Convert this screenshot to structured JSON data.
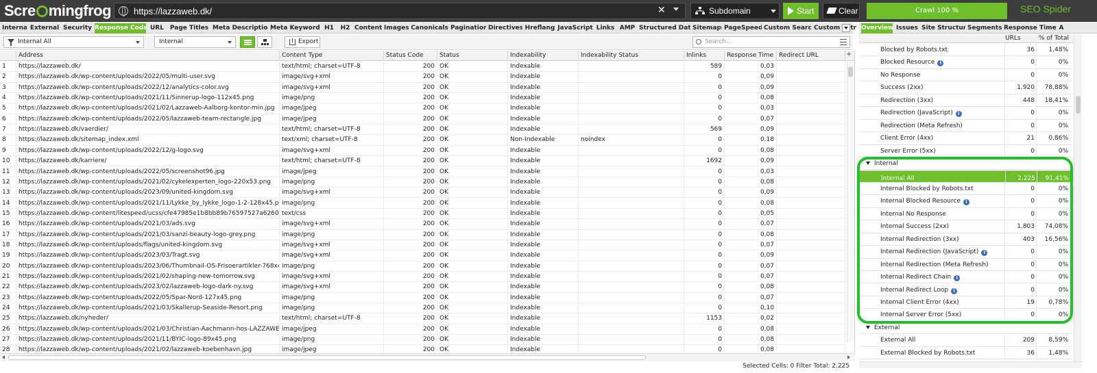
{
  "app": {
    "logo_pre": "Scre",
    "logo_post": "mingfrog",
    "brand": "SEO Spider",
    "url": "https://lazzaweb.dk/",
    "url_clear": "✕",
    "mode": "Subdomain",
    "start_label": "Start",
    "clear_label": "Clear",
    "progress_label": "Crawl 100 %",
    "progress_value": 1.0,
    "accent_color": "#6fbf2c"
  },
  "tabs": [
    {
      "label": "Internal",
      "active": false
    },
    {
      "label": "External",
      "active": false
    },
    {
      "label": "Security",
      "active": false
    },
    {
      "label": "Response Codes",
      "active": true
    },
    {
      "label": "URL",
      "active": false
    },
    {
      "label": "Page Titles",
      "active": false
    },
    {
      "label": "Meta Description",
      "active": false
    },
    {
      "label": "Meta Keywords",
      "active": false
    },
    {
      "label": "H1",
      "active": false
    },
    {
      "label": "H2",
      "active": false
    },
    {
      "label": "Content",
      "active": false
    },
    {
      "label": "Images",
      "active": false
    },
    {
      "label": "Canonicals",
      "active": false
    },
    {
      "label": "Pagination",
      "active": false
    },
    {
      "label": "Directives",
      "active": false
    },
    {
      "label": "Hreflang",
      "active": false
    },
    {
      "label": "JavaScript",
      "active": false
    },
    {
      "label": "Links",
      "active": false
    },
    {
      "label": "AMP",
      "active": false
    },
    {
      "label": "Structured Data",
      "active": false
    },
    {
      "label": "Sitemaps",
      "active": false
    },
    {
      "label": "PageSpeed",
      "active": false
    },
    {
      "label": "Custom Search",
      "active": false
    },
    {
      "label": "Custom Extrac",
      "active": false
    }
  ],
  "filterbar": {
    "filter": "Internal All",
    "scope": "Internal",
    "export_label": "Export",
    "search_placeholder": "Search..."
  },
  "grid": {
    "columns": [
      "Address",
      "Content Type",
      "Status Code",
      "Status",
      "Indexability",
      "Indexability Status",
      "Inlinks",
      "Response Time",
      "Redirect URL"
    ],
    "rows": [
      [
        "1",
        "https://lazzaweb.dk/",
        "text/html; charset=UTF-8",
        "200",
        "OK",
        "Indexable",
        "",
        "589",
        "0,03"
      ],
      [
        "2",
        "https://lazzaweb.dk/wp-content/uploads/2022/05/multi-user.svg",
        "image/svg+xml",
        "200",
        "OK",
        "Indexable",
        "",
        "0",
        "0,09"
      ],
      [
        "3",
        "https://lazzaweb.dk/wp-content/uploads/2022/12/analytics-color.svg",
        "image/svg+xml",
        "200",
        "OK",
        "Indexable",
        "",
        "0",
        "0,09"
      ],
      [
        "4",
        "https://lazzaweb.dk/wp-content/uploads/2021/11/Sinnerup-logo-112x45.png",
        "image/png",
        "200",
        "OK",
        "Indexable",
        "",
        "0",
        "0,08"
      ],
      [
        "5",
        "https://lazzaweb.dk/wp-content/uploads/2021/02/Lazzaweb-Aalborg-kontor-min.jpg",
        "image/jpeg",
        "200",
        "OK",
        "Indexable",
        "",
        "0",
        "0,03"
      ],
      [
        "6",
        "https://lazzaweb.dk/wp-content/uploads/2022/05/lazzaweb-team-rectangle.jpg",
        "image/jpeg",
        "200",
        "OK",
        "Indexable",
        "",
        "0",
        "0,07"
      ],
      [
        "7",
        "https://lazzaweb.dk/vaerdier/",
        "text/html; charset=UTF-8",
        "200",
        "OK",
        "Indexable",
        "",
        "569",
        "0,09"
      ],
      [
        "8",
        "https://lazzaweb.dk/sitemap_index.xml",
        "text/xml; charset=UTF-8",
        "200",
        "OK",
        "Non-Indexable",
        "noindex",
        "0",
        "0,18"
      ],
      [
        "9",
        "https://lazzaweb.dk/wp-content/uploads/2022/12/g-logo.svg",
        "image/svg+xml",
        "200",
        "OK",
        "Indexable",
        "",
        "0",
        "0,08"
      ],
      [
        "10",
        "https://lazzaweb.dk/karriere/",
        "text/html; charset=UTF-8",
        "200",
        "OK",
        "Indexable",
        "",
        "1692",
        "0,09"
      ],
      [
        "11",
        "https://lazzaweb.dk/wp-content/uploads/2022/05/screenshot96.jpg",
        "image/jpeg",
        "200",
        "OK",
        "Indexable",
        "",
        "0",
        "0,03"
      ],
      [
        "12",
        "https://lazzaweb.dk/wp-content/uploads/2021/02/cykelexperten_logo-220x53.png",
        "image/png",
        "200",
        "OK",
        "Indexable",
        "",
        "0",
        "0,08"
      ],
      [
        "13",
        "https://lazzaweb.dk/wp-content/uploads/2023/09/united-kingdom.svg",
        "image/svg+xml",
        "200",
        "OK",
        "Indexable",
        "",
        "0",
        "0,09"
      ],
      [
        "14",
        "https://lazzaweb.dk/wp-content/uploads/2021/11/Lykke_by_lykke_logo-1-2-128x45.png",
        "image/png",
        "200",
        "OK",
        "Indexable",
        "",
        "0",
        "0,08"
      ],
      [
        "15",
        "https://lazzaweb.dk/wp-content/litespeed/ucss/cfe47985e1b8bb89b76597527a62603e.c...",
        "text/css",
        "200",
        "OK",
        "Indexable",
        "",
        "0",
        "0,05"
      ],
      [
        "16",
        "https://lazzaweb.dk/wp-content/uploads/2021/03/ads.svg",
        "image/svg+xml",
        "200",
        "OK",
        "Indexable",
        "",
        "0",
        "0,07"
      ],
      [
        "17",
        "https://lazzaweb.dk/wp-content/uploads/2021/03/sanzi-beauty-logo-grey.png",
        "image/png",
        "200",
        "OK",
        "Indexable",
        "",
        "0",
        "0,08"
      ],
      [
        "18",
        "https://lazzaweb.dk/wp-content/uploads/flags/united-kingdom.svg",
        "image/svg+xml",
        "200",
        "OK",
        "Indexable",
        "",
        "0",
        "0,07"
      ],
      [
        "19",
        "https://lazzaweb.dk/wp-content/uploads/2023/03/Tragt.svg",
        "image/svg+xml",
        "200",
        "OK",
        "Indexable",
        "",
        "0",
        "0,09"
      ],
      [
        "20",
        "https://lazzaweb.dk/wp-content/uploads/2023/06/Thumbnail-OS-Frisoerartikler-768x432....",
        "image/png",
        "200",
        "OK",
        "Indexable",
        "",
        "0",
        "0,07"
      ],
      [
        "21",
        "https://lazzaweb.dk/wp-content/uploads/2021/02/shaping-new-tomorrow.svg",
        "image/svg+xml",
        "200",
        "OK",
        "Indexable",
        "",
        "0",
        "0,07"
      ],
      [
        "22",
        "https://lazzaweb.dk/wp-content/uploads/2023/02/lazzaweb-logo-dark-ny.svg",
        "image/svg+xml",
        "200",
        "OK",
        "Indexable",
        "",
        "0",
        "0,08"
      ],
      [
        "23",
        "https://lazzaweb.dk/wp-content/uploads/2022/05/Spar-Nord-127x45.png",
        "image/png",
        "200",
        "OK",
        "Indexable",
        "",
        "0",
        "0,07"
      ],
      [
        "24",
        "https://lazzaweb.dk/wp-content/uploads/2021/03/Skallerup-Seaside-Resort.png",
        "image/png",
        "200",
        "OK",
        "Indexable",
        "",
        "0",
        "0,10"
      ],
      [
        "25",
        "https://lazzaweb.dk/nyheder/",
        "text/html; charset=UTF-8",
        "200",
        "OK",
        "Indexable",
        "",
        "1153",
        "0,02"
      ],
      [
        "26",
        "https://lazzaweb.dk/wp-content/uploads/2021/03/Christian-Aachmann-hos-LAZZAWEB-4...",
        "image/jpeg",
        "200",
        "OK",
        "Indexable",
        "",
        "0",
        "0,08"
      ],
      [
        "27",
        "https://lazzaweb.dk/wp-content/uploads/2021/11/BYIC-logo-89x45.png",
        "image/png",
        "200",
        "OK",
        "Indexable",
        "",
        "0",
        "0,08"
      ],
      [
        "28",
        "https://lazzaweb.dk/wp-content/uploads/2021/02/lazzaweb-koebenhavn.jpg",
        "image/jpeg",
        "200",
        "OK",
        "Indexable",
        "",
        "0",
        "0,08"
      ]
    ]
  },
  "statusbar": {
    "text": "Selected Cells: 0 Filter Total: 2.225"
  },
  "right_tabs": [
    {
      "label": "Overview",
      "active": true
    },
    {
      "label": "Issues",
      "active": false
    },
    {
      "label": "Site Structure",
      "active": false
    },
    {
      "label": "Segments",
      "active": false
    },
    {
      "label": "Response Times",
      "active": false
    },
    {
      "label": "A",
      "active": false
    }
  ],
  "overview": {
    "col_urls": "URLs",
    "col_pct": "% of Total",
    "rows": [
      {
        "label": "Blocked by Robots.txt",
        "urls": "36",
        "pct": "1,48%",
        "info": false,
        "type": "item"
      },
      {
        "label": "Blocked Resource",
        "urls": "0",
        "pct": "0%",
        "info": true,
        "type": "item"
      },
      {
        "label": "No Response",
        "urls": "0",
        "pct": "0%",
        "info": false,
        "type": "item"
      },
      {
        "label": "Success (2xx)",
        "urls": "1.920",
        "pct": "78,88%",
        "info": false,
        "type": "item"
      },
      {
        "label": "Redirection (3xx)",
        "urls": "448",
        "pct": "18,41%",
        "info": false,
        "type": "item"
      },
      {
        "label": "Redirection (JavaScript)",
        "urls": "0",
        "pct": "0%",
        "info": true,
        "type": "item"
      },
      {
        "label": "Redirection (Meta Refresh)",
        "urls": "0",
        "pct": "0%",
        "info": false,
        "type": "item"
      },
      {
        "label": "Client Error (4xx)",
        "urls": "21",
        "pct": "0,86%",
        "info": false,
        "type": "item"
      },
      {
        "label": "Server Error (5xx)",
        "urls": "0",
        "pct": "0%",
        "info": false,
        "type": "item"
      },
      {
        "label": "Internal",
        "urls": "",
        "pct": "",
        "info": false,
        "type": "section"
      },
      {
        "label": "Internal All",
        "urls": "2.225",
        "pct": "91,41%",
        "info": false,
        "type": "selected"
      },
      {
        "label": "Internal Blocked by Robots.txt",
        "urls": "0",
        "pct": "0%",
        "info": false,
        "type": "item"
      },
      {
        "label": "Internal Blocked Resource",
        "urls": "0",
        "pct": "0%",
        "info": true,
        "type": "item"
      },
      {
        "label": "Internal No Response",
        "urls": "0",
        "pct": "0%",
        "info": false,
        "type": "item"
      },
      {
        "label": "Internal Success (2xx)",
        "urls": "1.803",
        "pct": "74,08%",
        "info": false,
        "type": "item"
      },
      {
        "label": "Internal Redirection (3xx)",
        "urls": "403",
        "pct": "16,56%",
        "info": false,
        "type": "item"
      },
      {
        "label": "Internal Redirection (JavaScript)",
        "urls": "0",
        "pct": "0%",
        "info": true,
        "type": "item"
      },
      {
        "label": "Internal Redirection (Meta Refresh)",
        "urls": "0",
        "pct": "0%",
        "info": false,
        "type": "item"
      },
      {
        "label": "Internal Redirect Chain",
        "urls": "0",
        "pct": "0%",
        "info": true,
        "type": "item"
      },
      {
        "label": "Internal Redirect Loop",
        "urls": "0",
        "pct": "0%",
        "info": true,
        "type": "item"
      },
      {
        "label": "Internal Client Error (4xx)",
        "urls": "19",
        "pct": "0,78%",
        "info": false,
        "type": "item"
      },
      {
        "label": "Internal Server Error (5xx)",
        "urls": "0",
        "pct": "0%",
        "info": false,
        "type": "item"
      },
      {
        "label": "External",
        "urls": "",
        "pct": "",
        "info": false,
        "type": "section"
      },
      {
        "label": "External All",
        "urls": "209",
        "pct": "8,59%",
        "info": false,
        "type": "item"
      },
      {
        "label": "External Blocked by Robots.txt",
        "urls": "36",
        "pct": "1,48%",
        "info": false,
        "type": "item"
      }
    ]
  },
  "info_glyph": "i"
}
